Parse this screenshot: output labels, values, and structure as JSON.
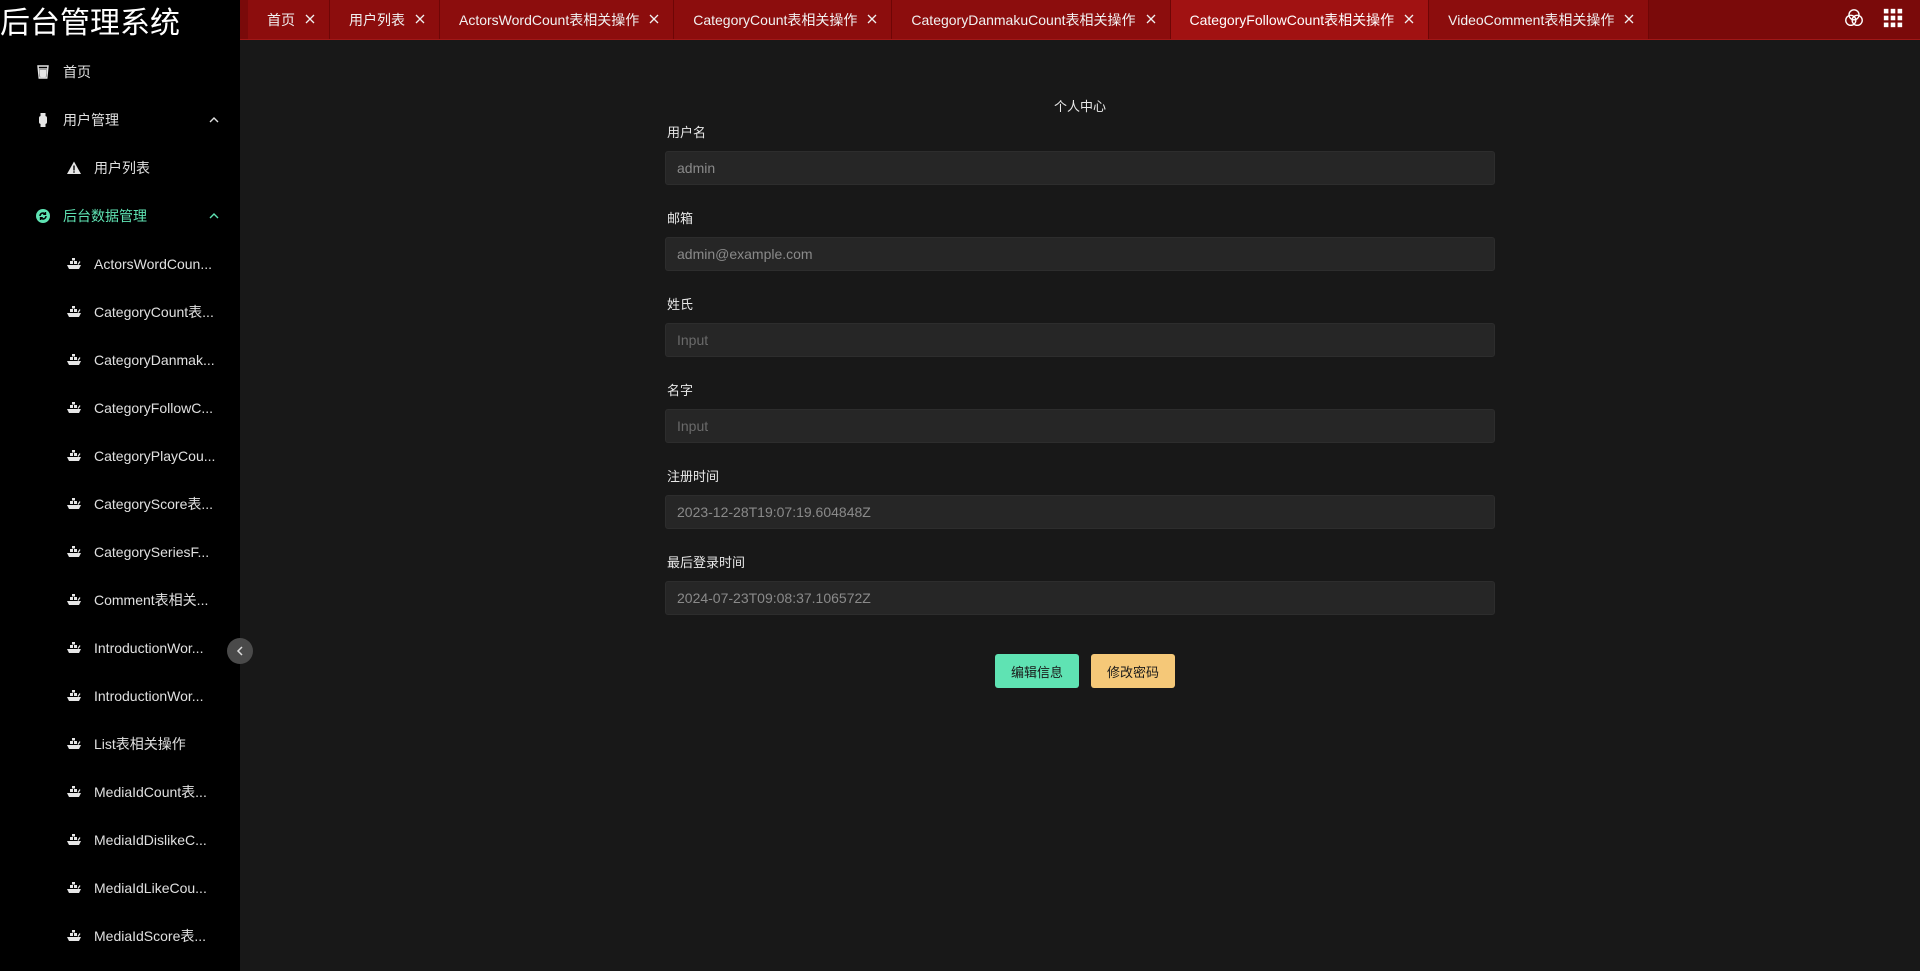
{
  "app": {
    "title": "后台管理系统"
  },
  "sidebar": {
    "items": [
      {
        "label": "首页",
        "icon": "cup-icon",
        "level": 1,
        "active": false
      },
      {
        "label": "用户管理",
        "icon": "watch-icon",
        "level": 1,
        "active": false,
        "expanded": true
      },
      {
        "label": "用户列表",
        "icon": "warning-icon",
        "level": 2,
        "active": false
      },
      {
        "label": "后台数据管理",
        "icon": "refresh-icon",
        "level": 1,
        "active": true,
        "expanded": true
      },
      {
        "label": "ActorsWordCoun...",
        "icon": "ship-icon",
        "level": 2
      },
      {
        "label": "CategoryCount表...",
        "icon": "ship-icon",
        "level": 2
      },
      {
        "label": "CategoryDanmak...",
        "icon": "ship-icon",
        "level": 2
      },
      {
        "label": "CategoryFollowC...",
        "icon": "ship-icon",
        "level": 2
      },
      {
        "label": "CategoryPlayCou...",
        "icon": "ship-icon",
        "level": 2
      },
      {
        "label": "CategoryScore表...",
        "icon": "ship-icon",
        "level": 2
      },
      {
        "label": "CategorySeriesF...",
        "icon": "ship-icon",
        "level": 2
      },
      {
        "label": "Comment表相关...",
        "icon": "ship-icon",
        "level": 2
      },
      {
        "label": "IntroductionWor...",
        "icon": "ship-icon",
        "level": 2
      },
      {
        "label": "IntroductionWor...",
        "icon": "ship-icon",
        "level": 2
      },
      {
        "label": "List表相关操作",
        "icon": "ship-icon",
        "level": 2
      },
      {
        "label": "MediaIdCount表...",
        "icon": "ship-icon",
        "level": 2
      },
      {
        "label": "MediaIdDislikeC...",
        "icon": "ship-icon",
        "level": 2
      },
      {
        "label": "MediaIdLikeCou...",
        "icon": "ship-icon",
        "level": 2
      },
      {
        "label": "MediaIdScore表...",
        "icon": "ship-icon",
        "level": 2
      }
    ]
  },
  "tabs": [
    {
      "label": "首页",
      "current": false
    },
    {
      "label": "用户列表",
      "current": false
    },
    {
      "label": "ActorsWordCount表相关操作",
      "current": false
    },
    {
      "label": "CategoryCount表相关操作",
      "current": false
    },
    {
      "label": "CategoryDanmakuCount表相关操作",
      "current": false
    },
    {
      "label": "CategoryFollowCount表相关操作",
      "current": true
    },
    {
      "label": "VideoComment表相关操作",
      "current": false
    }
  ],
  "profile": {
    "title": "个人中心",
    "fields": [
      {
        "label": "用户名",
        "value": "admin",
        "placeholder": ""
      },
      {
        "label": "邮箱",
        "value": "admin@example.com",
        "placeholder": ""
      },
      {
        "label": "姓氏",
        "value": "",
        "placeholder": "Input"
      },
      {
        "label": "名字",
        "value": "",
        "placeholder": "Input"
      },
      {
        "label": "注册时间",
        "value": "2023-12-28T19:07:19.604848Z",
        "placeholder": ""
      },
      {
        "label": "最后登录时间",
        "value": "2024-07-23T09:08:37.106572Z",
        "placeholder": ""
      }
    ],
    "edit_label": "编辑信息",
    "password_label": "修改密码"
  },
  "colors": {
    "accent": "#5fe3b3",
    "warning_button": "#f5c878",
    "topbar": "#8c0d0d"
  }
}
